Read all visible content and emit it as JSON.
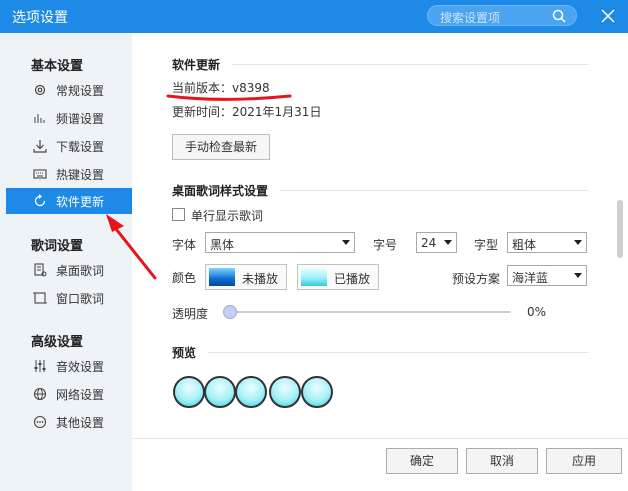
{
  "window": {
    "title": "选项设置",
    "search_placeholder": "搜索设置项"
  },
  "sidebar": {
    "groups": [
      {
        "label": "基本设置",
        "items": [
          {
            "label": "常规设置"
          },
          {
            "label": "频谱设置"
          },
          {
            "label": "下载设置"
          },
          {
            "label": "热键设置"
          },
          {
            "label": "软件更新",
            "active": true
          }
        ]
      },
      {
        "label": "歌词设置",
        "items": [
          {
            "label": "桌面歌词"
          },
          {
            "label": "窗口歌词"
          }
        ]
      },
      {
        "label": "高级设置",
        "items": [
          {
            "label": "音效设置"
          },
          {
            "label": "网络设置"
          },
          {
            "label": "其他设置"
          }
        ]
      }
    ]
  },
  "update": {
    "section_title": "软件更新",
    "current_version": "当前版本：v8398",
    "update_time": "更新时间：2021年1月31日",
    "check_button": "手动检查最新"
  },
  "lyric_style": {
    "section_title": "桌面歌词样式设置",
    "single_line_label": "单行显示歌词",
    "single_line_checked": false,
    "font_label": "字体",
    "font_value": "黑体",
    "size_label": "字号",
    "size_value": "24",
    "weight_label": "字型",
    "weight_value": "粗体",
    "color_label": "颜色",
    "not_played_label": "未播放",
    "played_label": "已播放",
    "preset_label": "预设方案",
    "preset_value": "海洋蓝",
    "opacity_label": "透明度",
    "opacity_value": "0%",
    "opacity_fraction": 0
  },
  "preview": {
    "section_title": "预览"
  },
  "footer": {
    "ok": "确定",
    "cancel": "取消",
    "apply": "应用"
  },
  "colors": {
    "accent": "#1e8ae8",
    "sidebar_bg": "#eef3f8",
    "annotation": "#e8141b"
  }
}
